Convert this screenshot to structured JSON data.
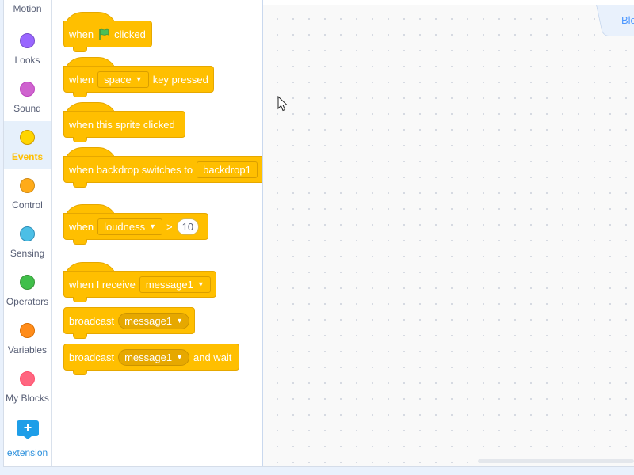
{
  "categories": [
    {
      "label": "Motion",
      "color": "#4c97ff",
      "selected": false
    },
    {
      "label": "Looks",
      "color": "#9966ff",
      "selected": false
    },
    {
      "label": "Sound",
      "color": "#cf63cf",
      "selected": false
    },
    {
      "label": "Events",
      "color": "#ffd500",
      "selected": true
    },
    {
      "label": "Control",
      "color": "#ffab19",
      "selected": false
    },
    {
      "label": "Sensing",
      "color": "#4cbfe6",
      "selected": false
    },
    {
      "label": "Operators",
      "color": "#40bf4a",
      "selected": false
    },
    {
      "label": "Variables",
      "color": "#ff8c1a",
      "selected": false
    },
    {
      "label": "My Blocks",
      "color": "#ff6680",
      "selected": false
    }
  ],
  "extension": {
    "label": "extension",
    "button_glyph": "+"
  },
  "blocks": {
    "flag_clicked": {
      "when": "when",
      "clicked": "clicked",
      "icon": "green-flag-icon"
    },
    "key_pressed": {
      "when": "when",
      "key": "space",
      "suffix": "key pressed"
    },
    "sprite_clicked": {
      "text": "when this sprite clicked"
    },
    "backdrop_switch": {
      "text": "when backdrop switches to",
      "value": "backdrop1"
    },
    "loudness": {
      "when": "when",
      "option": "loudness",
      "op": ">",
      "value": "10"
    },
    "receive": {
      "text": "when I receive",
      "value": "message1"
    },
    "broadcast": {
      "text": "broadcast",
      "value": "message1"
    },
    "broadcast_wait": {
      "text": "broadcast",
      "value": "message1",
      "suffix": "and wait"
    }
  },
  "workspace": {
    "tab_label": "Blo"
  },
  "colors": {
    "events_block": "#ffbf00",
    "events_border": "#e6a800",
    "accent": "#4c97ff"
  }
}
